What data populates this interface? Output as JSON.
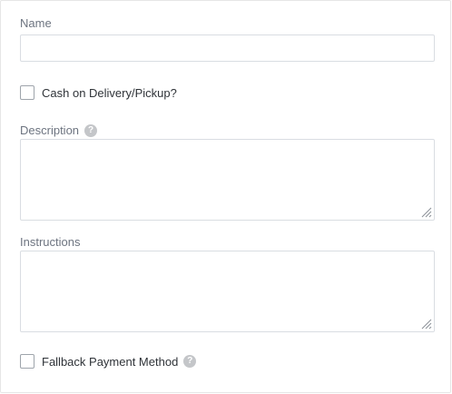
{
  "form": {
    "name_label": "Name",
    "name_value": "",
    "cod_label": "Cash on Delivery/Pickup?",
    "cod_checked": false,
    "description_label": "Description",
    "description_value": "",
    "instructions_label": "Instructions",
    "instructions_value": "",
    "fallback_label": "Fallback Payment Method",
    "fallback_checked": false,
    "help_glyph": "?"
  },
  "icons": {
    "help": "help-circle-icon",
    "resize": "resize-grip-icon"
  },
  "colors": {
    "label": "#6d7480",
    "text": "#2f3338",
    "border": "#d9dde2",
    "help_icon": "#c4c6c9"
  }
}
